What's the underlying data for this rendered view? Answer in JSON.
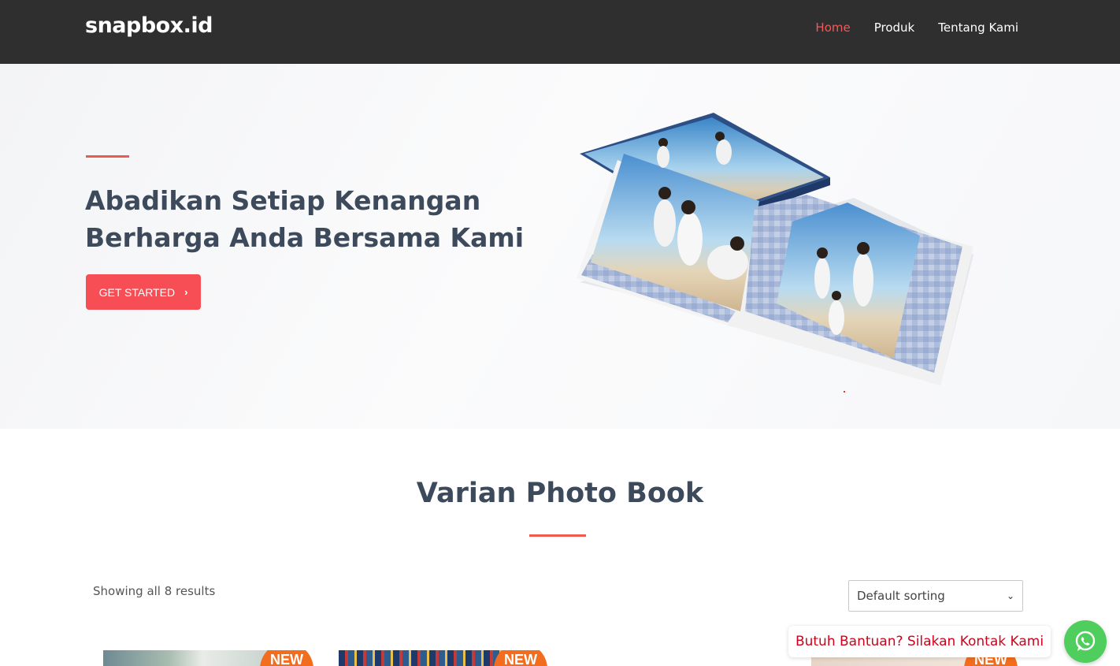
{
  "header": {
    "logo": "snapbox.id",
    "nav": [
      {
        "label": "Home",
        "active": true
      },
      {
        "label": "Produk",
        "active": false
      },
      {
        "label": "Tentang Kami",
        "active": false
      }
    ]
  },
  "hero": {
    "title_line1": "Abadikan Setiap Kenangan",
    "title_line2": "Berharga Anda Bersama Kami",
    "cta_label": "GET STARTED",
    "cta_icon": "chevron-right-icon"
  },
  "products": {
    "section_title": "Varian Photo Book",
    "result_count": "Showing all 8 results",
    "sort_selected": "Default sorting",
    "badge": "NEW"
  },
  "help": {
    "bubble_text": "Butuh Bantuan? Silakan Kontak Kami",
    "icon": "whatsapp-icon"
  },
  "colors": {
    "header_bg": "#2f2f2f",
    "accent": "#f74d55",
    "nav_active": "#f2595b",
    "badge": "#f26d1d",
    "whatsapp": "#4fce5d"
  }
}
